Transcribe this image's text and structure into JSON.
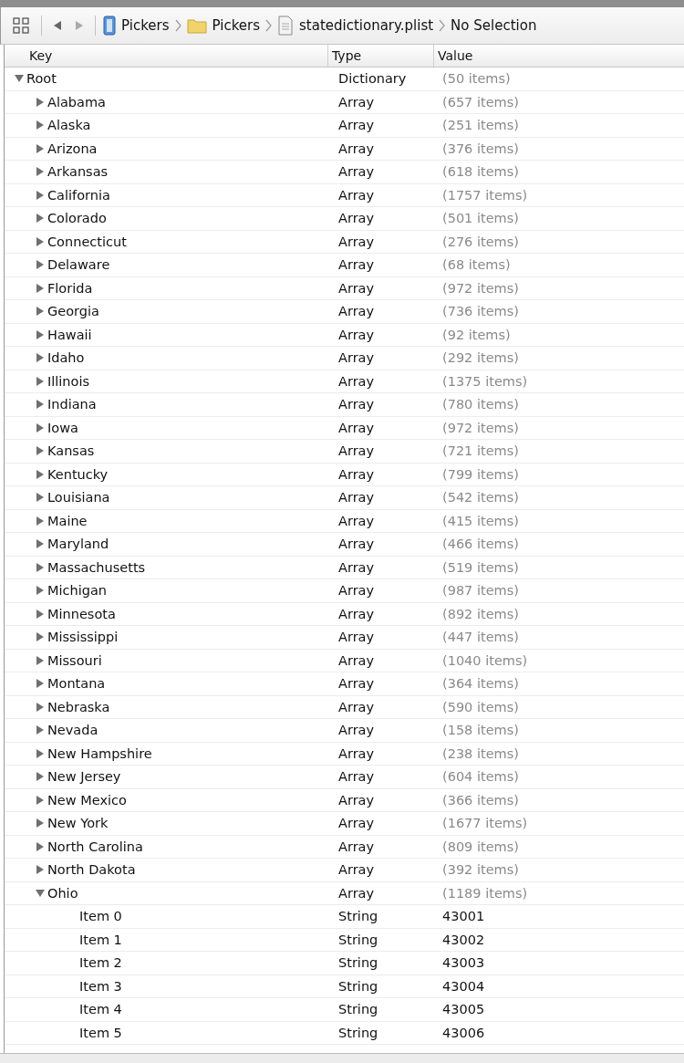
{
  "breadcrumb": [
    {
      "kind": "project",
      "label": "Pickers"
    },
    {
      "kind": "folder",
      "label": "Pickers"
    },
    {
      "kind": "file",
      "label": "statedictionary.plist"
    },
    {
      "kind": "none",
      "label": "No Selection"
    }
  ],
  "columns": [
    "Key",
    "Type",
    "Value"
  ],
  "tree": [
    {
      "key": "Root",
      "type": "Dictionary",
      "value": "(50 items)",
      "kind": "collection",
      "expanded": true,
      "children": [
        {
          "key": "Alabama",
          "type": "Array",
          "value": "(657 items)",
          "kind": "collection",
          "expanded": false
        },
        {
          "key": "Alaska",
          "type": "Array",
          "value": "(251 items)",
          "kind": "collection",
          "expanded": false
        },
        {
          "key": "Arizona",
          "type": "Array",
          "value": "(376 items)",
          "kind": "collection",
          "expanded": false
        },
        {
          "key": "Arkansas",
          "type": "Array",
          "value": "(618 items)",
          "kind": "collection",
          "expanded": false
        },
        {
          "key": "California",
          "type": "Array",
          "value": "(1757 items)",
          "kind": "collection",
          "expanded": false
        },
        {
          "key": "Colorado",
          "type": "Array",
          "value": "(501 items)",
          "kind": "collection",
          "expanded": false
        },
        {
          "key": "Connecticut",
          "type": "Array",
          "value": "(276 items)",
          "kind": "collection",
          "expanded": false
        },
        {
          "key": "Delaware",
          "type": "Array",
          "value": "(68 items)",
          "kind": "collection",
          "expanded": false
        },
        {
          "key": "Florida",
          "type": "Array",
          "value": "(972 items)",
          "kind": "collection",
          "expanded": false
        },
        {
          "key": "Georgia",
          "type": "Array",
          "value": "(736 items)",
          "kind": "collection",
          "expanded": false
        },
        {
          "key": "Hawaii",
          "type": "Array",
          "value": "(92 items)",
          "kind": "collection",
          "expanded": false
        },
        {
          "key": "Idaho",
          "type": "Array",
          "value": "(292 items)",
          "kind": "collection",
          "expanded": false
        },
        {
          "key": "Illinois",
          "type": "Array",
          "value": "(1375 items)",
          "kind": "collection",
          "expanded": false
        },
        {
          "key": "Indiana",
          "type": "Array",
          "value": "(780 items)",
          "kind": "collection",
          "expanded": false
        },
        {
          "key": "Iowa",
          "type": "Array",
          "value": "(972 items)",
          "kind": "collection",
          "expanded": false
        },
        {
          "key": "Kansas",
          "type": "Array",
          "value": "(721 items)",
          "kind": "collection",
          "expanded": false
        },
        {
          "key": "Kentucky",
          "type": "Array",
          "value": "(799 items)",
          "kind": "collection",
          "expanded": false
        },
        {
          "key": "Louisiana",
          "type": "Array",
          "value": "(542 items)",
          "kind": "collection",
          "expanded": false
        },
        {
          "key": "Maine",
          "type": "Array",
          "value": "(415 items)",
          "kind": "collection",
          "expanded": false
        },
        {
          "key": "Maryland",
          "type": "Array",
          "value": "(466 items)",
          "kind": "collection",
          "expanded": false
        },
        {
          "key": "Massachusetts",
          "type": "Array",
          "value": "(519 items)",
          "kind": "collection",
          "expanded": false
        },
        {
          "key": "Michigan",
          "type": "Array",
          "value": "(987 items)",
          "kind": "collection",
          "expanded": false
        },
        {
          "key": "Minnesota",
          "type": "Array",
          "value": "(892 items)",
          "kind": "collection",
          "expanded": false
        },
        {
          "key": "Mississippi",
          "type": "Array",
          "value": "(447 items)",
          "kind": "collection",
          "expanded": false
        },
        {
          "key": "Missouri",
          "type": "Array",
          "value": "(1040 items)",
          "kind": "collection",
          "expanded": false
        },
        {
          "key": "Montana",
          "type": "Array",
          "value": "(364 items)",
          "kind": "collection",
          "expanded": false
        },
        {
          "key": "Nebraska",
          "type": "Array",
          "value": "(590 items)",
          "kind": "collection",
          "expanded": false
        },
        {
          "key": "Nevada",
          "type": "Array",
          "value": "(158 items)",
          "kind": "collection",
          "expanded": false
        },
        {
          "key": "New Hampshire",
          "type": "Array",
          "value": "(238 items)",
          "kind": "collection",
          "expanded": false
        },
        {
          "key": "New Jersey",
          "type": "Array",
          "value": "(604 items)",
          "kind": "collection",
          "expanded": false
        },
        {
          "key": "New Mexico",
          "type": "Array",
          "value": "(366 items)",
          "kind": "collection",
          "expanded": false
        },
        {
          "key": "New York",
          "type": "Array",
          "value": "(1677 items)",
          "kind": "collection",
          "expanded": false
        },
        {
          "key": "North Carolina",
          "type": "Array",
          "value": "(809 items)",
          "kind": "collection",
          "expanded": false
        },
        {
          "key": "North Dakota",
          "type": "Array",
          "value": "(392 items)",
          "kind": "collection",
          "expanded": false
        },
        {
          "key": "Ohio",
          "type": "Array",
          "value": "(1189 items)",
          "kind": "collection",
          "expanded": true,
          "children": [
            {
              "key": "Item 0",
              "type": "String",
              "value": "43001",
              "kind": "value"
            },
            {
              "key": "Item 1",
              "type": "String",
              "value": "43002",
              "kind": "value"
            },
            {
              "key": "Item 2",
              "type": "String",
              "value": "43003",
              "kind": "value"
            },
            {
              "key": "Item 3",
              "type": "String",
              "value": "43004",
              "kind": "value"
            },
            {
              "key": "Item 4",
              "type": "String",
              "value": "43005",
              "kind": "value"
            },
            {
              "key": "Item 5",
              "type": "String",
              "value": "43006",
              "kind": "value"
            }
          ]
        }
      ]
    }
  ]
}
